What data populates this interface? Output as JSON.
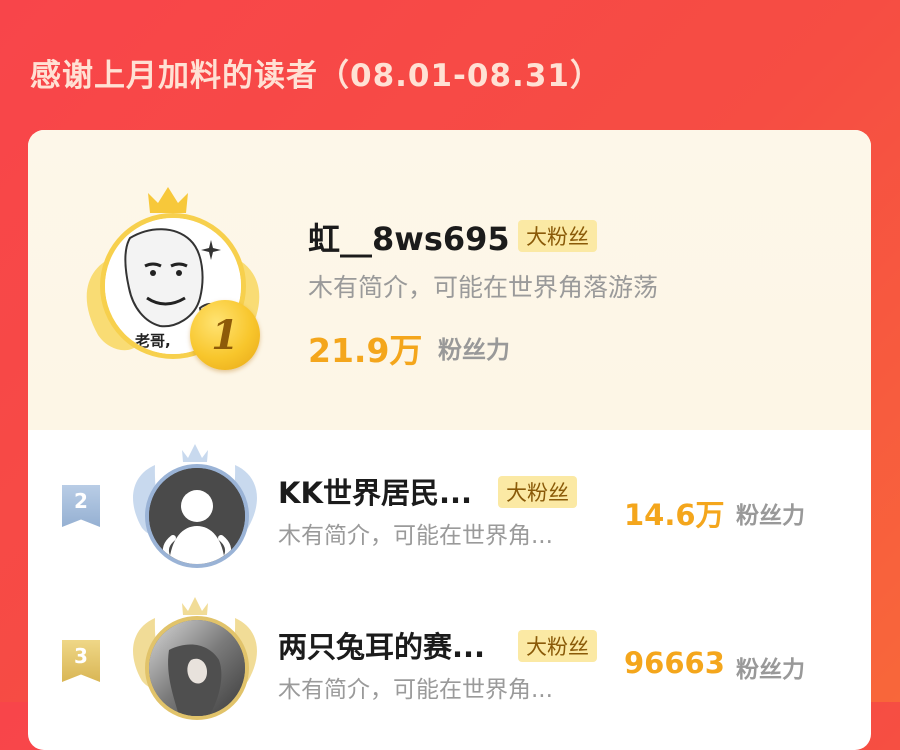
{
  "title": "感谢上月加料的读者（08.01-08.31）",
  "colors": {
    "background": "#f8454a",
    "gold": "#f7d04d",
    "fans_number": "#f4a61c",
    "badge_bg": "#fbe9a4",
    "silver": "#a9c1dd",
    "bronze": "#e3c46a"
  },
  "top_reader": {
    "rank": "1",
    "name": "虹__8ws695",
    "badge": "大粉丝",
    "bio": "木有简介，可能在世界角落游荡",
    "fans_value": "21.9万",
    "fans_label": "粉丝力",
    "avatar_caption": "老哥,",
    "icons": [
      "crown-icon",
      "wings-icon",
      "meme-avatar"
    ]
  },
  "readers": [
    {
      "rank": "2",
      "name": "KK世界居民...",
      "badge": "大粉丝",
      "bio": "木有简介，可能在世界角...",
      "fans_value": "14.6万",
      "fans_label": "粉丝力"
    },
    {
      "rank": "3",
      "name": "两只兔耳的赛...",
      "badge": "大粉丝",
      "bio": "木有简介，可能在世界角...",
      "fans_value": "96663",
      "fans_label": "粉丝力"
    }
  ]
}
